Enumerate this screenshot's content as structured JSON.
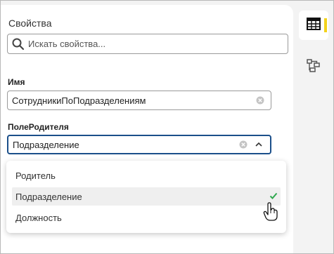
{
  "panel": {
    "title": "Свойства",
    "search": {
      "placeholder": "Искать свойства..."
    }
  },
  "fields": {
    "name": {
      "label": "Имя",
      "value": "СотрудникиПоПодразделениям"
    },
    "parent_field": {
      "label": "ПолеРодителя",
      "value": "Подразделение"
    }
  },
  "dropdown": {
    "options": [
      {
        "label": "Родитель",
        "selected": false
      },
      {
        "label": "Подразделение",
        "selected": true
      },
      {
        "label": "Должность",
        "selected": false
      }
    ]
  },
  "sidebar": {
    "items": [
      {
        "icon": "table-icon",
        "active": true
      },
      {
        "icon": "hierarchy-icon",
        "active": false
      }
    ]
  },
  "colors": {
    "accent": "#f3d21b",
    "focus_border": "#1b4f8a",
    "check": "#2fa84f"
  }
}
